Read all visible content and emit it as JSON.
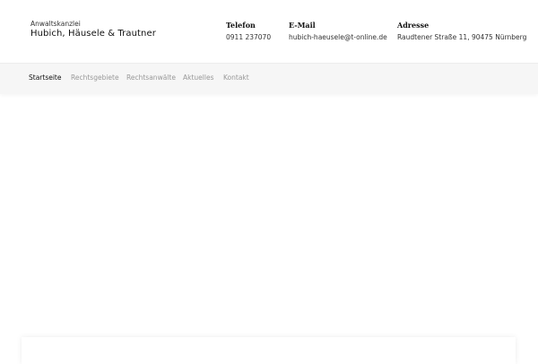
{
  "brand": {
    "subtitle": "Anwaltskanzlei",
    "name": "Hubich, Häusele & Trautner"
  },
  "contact": {
    "phone": {
      "label": "Telefon",
      "value": "0911 237070"
    },
    "email": {
      "label": "E-Mail",
      "value": "hubich-haeusele@t-online.de"
    },
    "address": {
      "label": "Adresse",
      "value": "Raudtener Straße 11, 90475 Nürnberg"
    }
  },
  "nav": {
    "items": [
      {
        "label": "Startseite",
        "active": true
      },
      {
        "label": "Rechtsgebiete",
        "active": false
      },
      {
        "label": "Rechtsanwälte",
        "active": false
      },
      {
        "label": "Aktuelles",
        "active": false
      },
      {
        "label": "Kontakt",
        "active": false
      }
    ]
  }
}
